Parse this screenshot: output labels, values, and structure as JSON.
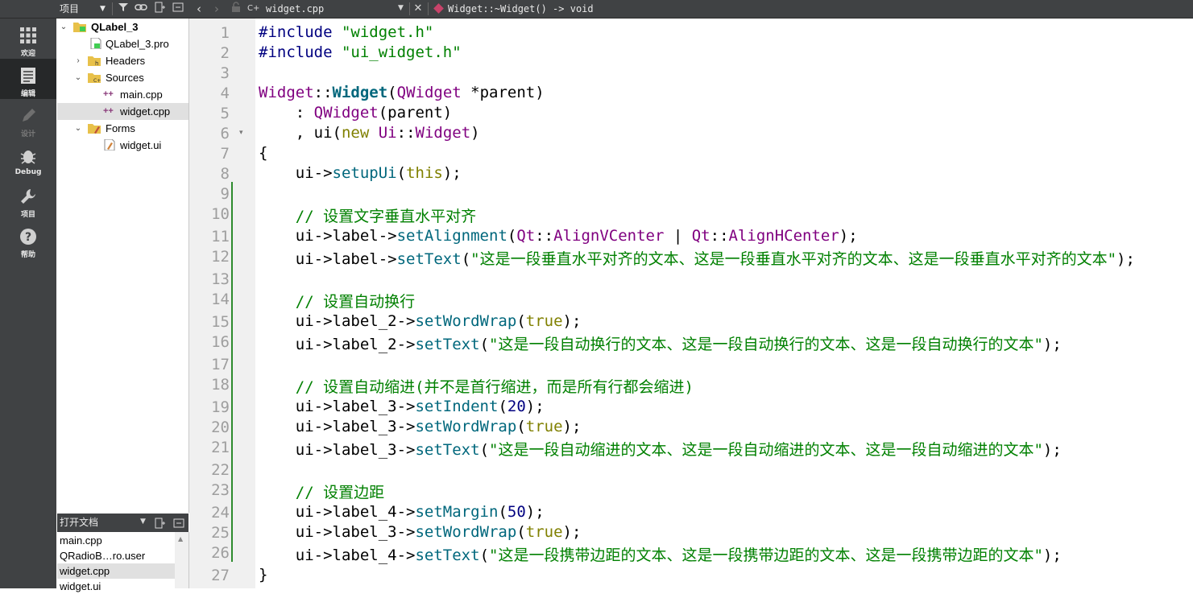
{
  "toolbar": {
    "project_combo": "项目",
    "file_combo": "widget.cpp",
    "symbol_combo": "Widget::~Widget() -> void",
    "icons": [
      "filter-icon",
      "link-icon",
      "split-icon",
      "close-icon",
      "back-icon",
      "forward-icon",
      "lock-icon",
      "file-icon",
      "chevron-down-icon",
      "close-doc-icon",
      "symbol-icon"
    ]
  },
  "modes": [
    {
      "label": "欢迎",
      "icon": "grid-icon"
    },
    {
      "label": "编辑",
      "icon": "edit-doc-icon"
    },
    {
      "label": "设计",
      "icon": "pencil-icon"
    },
    {
      "label": "Debug",
      "icon": "bug-icon"
    },
    {
      "label": "项目",
      "icon": "wrench-icon"
    },
    {
      "label": "帮助",
      "icon": "help-icon"
    }
  ],
  "tree": {
    "project": "QLabel_3",
    "pro_file": "QLabel_3.pro",
    "headers": "Headers",
    "sources": "Sources",
    "source_files": [
      "main.cpp",
      "widget.cpp"
    ],
    "forms": "Forms",
    "form_files": [
      "widget.ui"
    ]
  },
  "open_docs": {
    "title": "打开文档",
    "items": [
      "main.cpp",
      "QRadioB…ro.user",
      "widget.cpp",
      "widget.ui"
    ]
  },
  "editor": {
    "line_numbers": [
      "1",
      "2",
      "3",
      "4",
      "5",
      "6",
      "7",
      "8",
      "9",
      "10",
      "11",
      "12",
      "13",
      "14",
      "15",
      "16",
      "17",
      "18",
      "19",
      "20",
      "21",
      "22",
      "23",
      "24",
      "25",
      "26",
      "27"
    ],
    "s": {
      "include": "#include",
      "h1": "\"widget.h\"",
      "h2": "\"ui_widget.h\"",
      "widget": "Widget",
      "widget_bold": "Widget",
      "qwidget": "QWidget",
      "parent_decl": " *parent)",
      "init1": "    : ",
      "parent_arg": "(parent)",
      "init2": "    , ui(",
      "new": "new",
      "ui": "Ui",
      "brace_open": "{",
      "brace_close": "}",
      "setupui": "setupUi",
      "this": "this",
      "c1": "// 设置文字垂直水平对齐",
      "set_alignment": "setAlignment",
      "qt": "Qt",
      "align_v": "AlignVCenter",
      "align_h": "AlignHCenter",
      "set_text": "setText",
      "t1": "\"这是一段垂直水平对齐的文本、这是一段垂直水平对齐的文本、这是一段垂直水平对齐的文本\"",
      "c2": "// 设置自动换行",
      "set_word_wrap": "setWordWrap",
      "true": "true",
      "t2": "\"这是一段自动换行的文本、这是一段自动换行的文本、这是一段自动换行的文本\"",
      "c3": "// 设置自动缩进(并不是首行缩进，而是所有行都会缩进)",
      "set_indent": "setIndent",
      "n20": "20",
      "t3": "\"这是一段自动缩进的文本、这是一段自动缩进的文本、这是一段自动缩进的文本\"",
      "c4": "// 设置边距",
      "set_margin": "setMargin",
      "n50": "50",
      "t4": "\"这是一段携带边距的文本、这是一段携带边距的文本、这是一段携带边距的文本\"",
      "ui_arrow_label": "ui->label->",
      "ui_arrow_label2": "ui->label_2->",
      "ui_arrow_label3": "ui->label_3->",
      "ui_arrow_label4": "ui->label_4->",
      "ui_arrow": "ui->",
      "ind": "    ",
      "sep": "::",
      "pipe": " | ",
      "lp": "(",
      "rp": ")",
      "end": ");",
      "close_paren": ")"
    }
  }
}
